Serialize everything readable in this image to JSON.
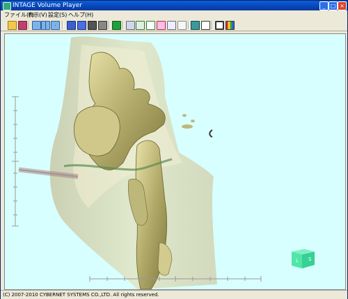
{
  "window": {
    "title": "INTAGE Volume Player",
    "controls": {
      "minimize": "_",
      "maximize": "□",
      "close": "×"
    }
  },
  "menu": [
    {
      "label": "ファイル(F)"
    },
    {
      "label": "表示(V)"
    },
    {
      "label": "設定(S)"
    },
    {
      "label": "ヘルプ(H)"
    }
  ],
  "toolbar": {
    "icons": [
      "open-folder-icon",
      "save-volume-icon",
      "single-view-icon",
      "two-view-icon",
      "four-view-icon",
      "cube-view-front-icon",
      "cube-view-side-icon",
      "cube-view-top-icon",
      "cube-view-iso-icon",
      "green-square-icon",
      "mpr-icon",
      "rotate-cube-icon",
      "cross-section-icon",
      "mip-icon",
      "clip-icon",
      "3d-object-icon",
      "landmark-icon",
      "window-icon",
      "color-palette-icon"
    ]
  },
  "viewport": {
    "orientation_cube": {
      "left_label": "L",
      "front_label": "S"
    }
  },
  "status": {
    "copyright": "(C) 2007-2010 CYBERNET SYSTEMS CO.,LTD. All rights reserved."
  },
  "colors": {
    "title_bar": "#0844b8",
    "viewport_bg": "#d8ffff",
    "bone": "#bdb77a",
    "cube": "#4fe6a8"
  }
}
